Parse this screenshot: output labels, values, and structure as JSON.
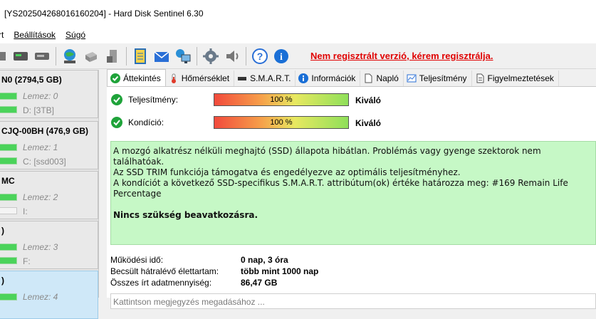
{
  "window": {
    "title": "[YS202504268016160204]  -  Hard Disk Sentinel 6.30"
  },
  "menu": [
    "rt",
    "Beállítások",
    "Súgó"
  ],
  "toolbar": {
    "icons": [
      "disk-icon",
      "disk-green-icon",
      "disk-ssd-icon",
      "network-globe-icon",
      "drive-icon",
      "tower-icon",
      "report-icon",
      "email-icon",
      "network-computer-icon",
      "gear-icon",
      "speaker-icon",
      "help-icon",
      "info-icon"
    ],
    "unregistered_text": "Nem regisztrált verzió, kérem regisztrálja."
  },
  "disks": [
    {
      "name": "N0 (2794,5 GB)",
      "lemez": "Lemez: 0",
      "vol": "D: [3TB]"
    },
    {
      "name": "CJQ-00BH (476,9 GB)",
      "lemez": "Lemez: 1",
      "vol": "C: [ssd003]"
    },
    {
      "name": "MC",
      "lemez": "Lemez: 2",
      "vol": "I:"
    },
    {
      "name": ")",
      "lemez": "Lemez: 3",
      "vol": "F:"
    },
    {
      "name": ")",
      "lemez": "Lemez: 4",
      "vol": ""
    }
  ],
  "tabs": [
    "Áttekintés",
    "Hőmérséklet",
    "S.M.A.R.T.",
    "Információk",
    "Napló",
    "Teljesítmény",
    "Figyelmeztetések"
  ],
  "metrics": {
    "performance": {
      "label": "Teljesítmény:",
      "value_text": "100 %",
      "value": 100,
      "status": "Kiváló"
    },
    "health": {
      "label": "Kondíció:",
      "value_text": "100 %",
      "value": 100,
      "status": "Kiváló"
    }
  },
  "info": {
    "lines": [
      "A mozgó alkatrész nélküli meghajtó (SSD) állapota hibátlan. Problémás vagy gyenge szektorok nem találhatóak.",
      "Az SSD TRIM funkciója támogatva és engedélyezve az optimális teljesítményhez.",
      "A kondíciót a következő SSD-specifikus S.M.A.R.T. attribútum(ok) értéke határozza meg:  #169 Remain Life Percentage"
    ],
    "action": "Nincs szükség beavatkozásra."
  },
  "stats": {
    "uptime_label": "Működési idő:",
    "uptime_value": "0 nap, 3 óra",
    "remaining_label": "Becsült hátralévő élettartam:",
    "remaining_value": "több mint 1000 nap",
    "written_label": "Összes írt adatmennyiség:",
    "written_value": "86,47 GB"
  },
  "comment": {
    "placeholder": "Kattintson megjegyzés megadásához ..."
  },
  "colors": {
    "unregistered": "#e00000",
    "info_bg": "#c6f8c6",
    "bar_green": "#4bd35a",
    "selected_disk": "#cfe8f8"
  }
}
